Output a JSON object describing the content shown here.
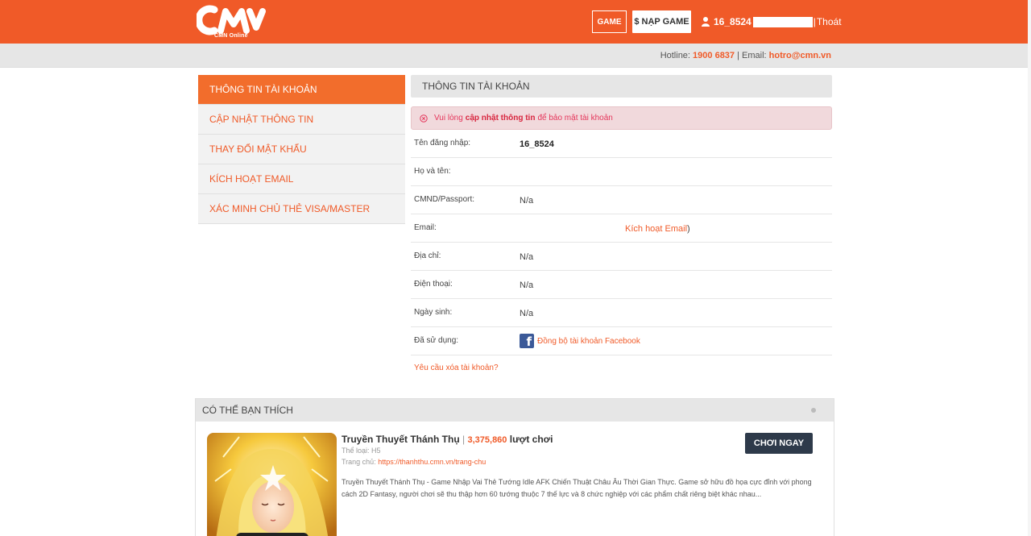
{
  "header": {
    "logo_sub": "CMN Online",
    "game_button": "GAME",
    "nap_game_button": "$ NẠP GAME",
    "username": "16_8524",
    "separator": "|",
    "logout": "Thoát"
  },
  "subbar": {
    "hotline_label": "Hotline:",
    "hotline_number": "1900 6837",
    "email_label": "| Email:",
    "email_value": "hotro@cmn.vn"
  },
  "sidebar": {
    "items": [
      {
        "label": "THÔNG TIN TÀI KHOẢN",
        "active": true
      },
      {
        "label": "CẬP NHẬT THÔNG TIN",
        "active": false
      },
      {
        "label": "THAY ĐỔI MẬT KHẨU",
        "active": false
      },
      {
        "label": "KÍCH HOẠT EMAIL",
        "active": false
      },
      {
        "label": "XÁC MINH CHỦ THẺ VISA/MASTER",
        "active": false
      }
    ]
  },
  "main": {
    "title": "THÔNG TIN TÀI KHOẢN",
    "alert_prefix": "Vui lòng",
    "alert_link": "cập nhật thông tin",
    "alert_suffix": "để bảo mật tài khoản",
    "rows": [
      {
        "label": "Tên đăng nhập:",
        "value": "16_8524"
      },
      {
        "label": "Họ và tên:",
        "value": ""
      },
      {
        "label": "CMND/Passport:",
        "value": "N/a"
      },
      {
        "label": "Email:",
        "value": "",
        "link": "Kích hoạt Email",
        "close": ")"
      },
      {
        "label": "Địa chỉ:",
        "value": "N/a"
      },
      {
        "label": "Điện thoại:",
        "value": "N/a"
      },
      {
        "label": "Ngày sinh:",
        "value": "N/a"
      },
      {
        "label": "Đã sử dụng:",
        "value": "",
        "link": "Đồng bộ tài khoản Facebook"
      }
    ],
    "delete_link": "Yêu cầu xóa tài khoản?"
  },
  "suggest": {
    "title": "CÓ THỂ BẠN THÍCH",
    "game": {
      "name": "Truyền Thuyết Thánh Thụ",
      "count": "3,375,860",
      "count_suffix": "lượt chơi",
      "genre": "Thể loại: H5",
      "home_label": "Trang chủ:",
      "home_url": "https://thanhthu.cmn.vn/trang-chu",
      "description": "Truyền Thuyết Thánh Thụ - Game Nhập Vai Thẻ Tướng Idle AFK Chiến Thuật Châu Âu Thời Gian Thực. Game sở hữu đồ họa cực đỉnh với phong cách 2D Fantasy, người chơi sẽ thu thập hơn 60 tướng thuộc 7 thế lực và 8 chức nghiệp với các phẩm chất riêng biệt khác nhau...",
      "play_button": "CHƠI NGAY"
    }
  },
  "colors": {
    "brand": "#f05a28",
    "dark_button": "#2e3a4a",
    "facebook": "#3b5998"
  }
}
